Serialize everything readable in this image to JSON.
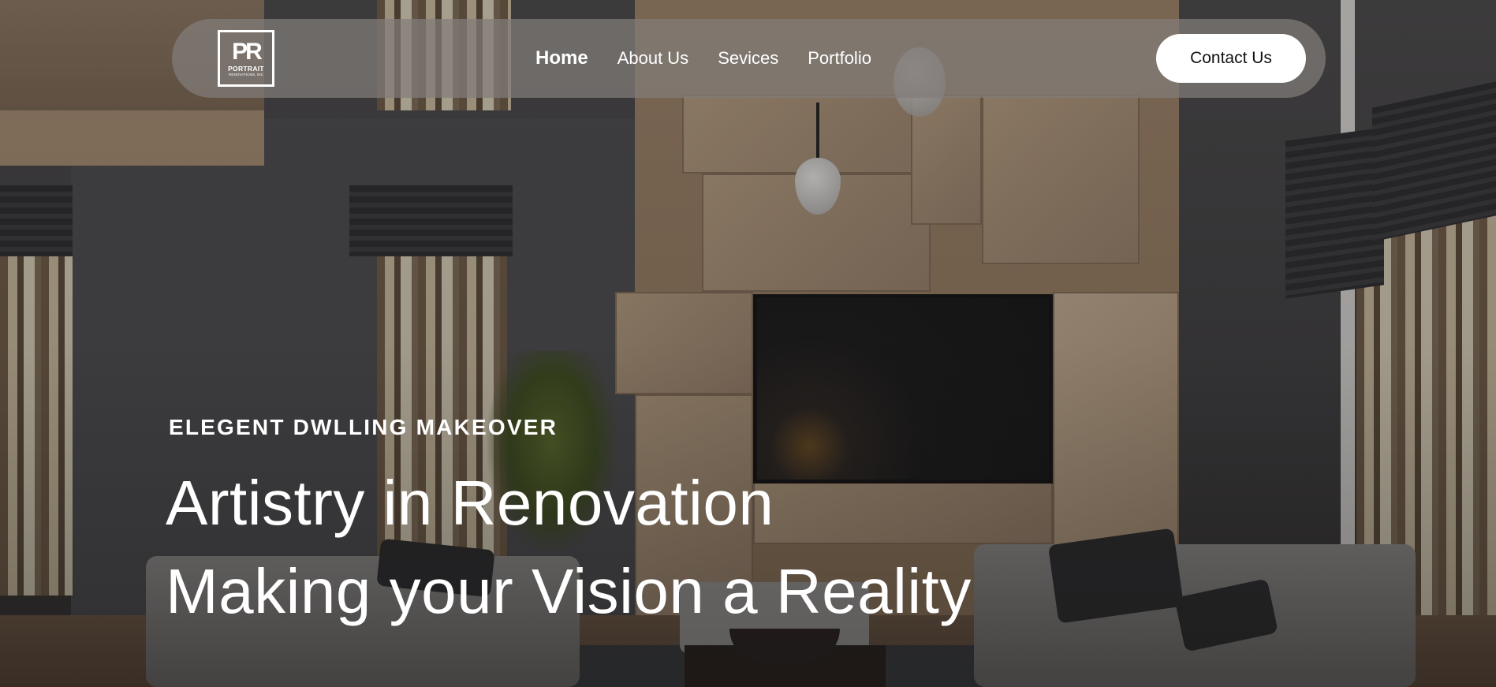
{
  "nav": {
    "logo": {
      "mark": "PR",
      "name": "PORTRAIT",
      "sub": "RENOVATIONS, INC"
    },
    "links": [
      {
        "label": "Home",
        "active": true
      },
      {
        "label": "About Us",
        "active": false
      },
      {
        "label": "Sevices",
        "active": false
      },
      {
        "label": "Portfolio",
        "active": false
      }
    ],
    "cta_label": "Contact Us"
  },
  "hero": {
    "eyebrow": "ELEGENT DWLLING MAKEOVER",
    "headline_line1": "Artistry in Renovation",
    "headline_line2": "Making your Vision a Reality",
    "background": "living-room-interior-photo"
  },
  "colors": {
    "nav_bg": "#827d7a",
    "text": "#ffffff",
    "cta_bg": "#ffffff",
    "cta_text": "#111111"
  }
}
